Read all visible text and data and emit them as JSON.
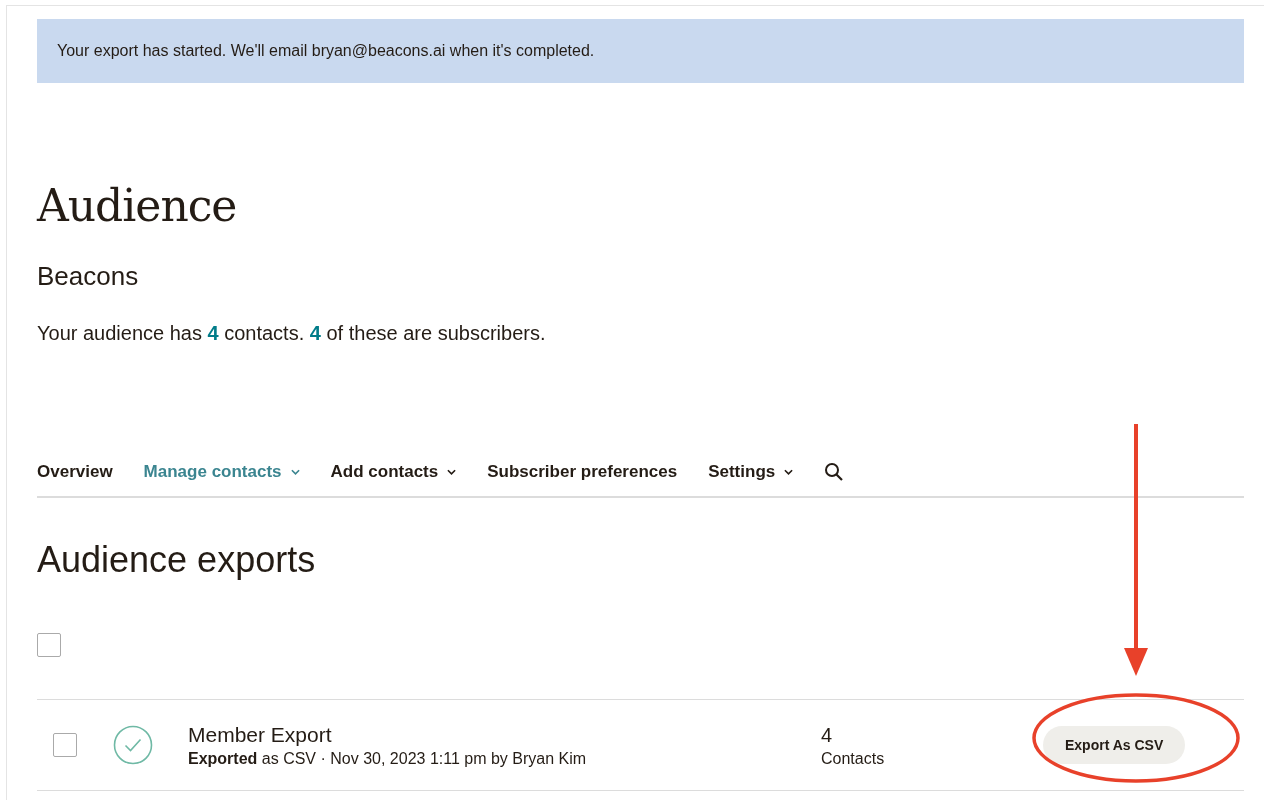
{
  "banner": {
    "text": "Your export has started. We'll email bryan@beacons.ai when it's completed."
  },
  "page_title": "Audience",
  "audience_name": "Beacons",
  "summary": [
    {
      "kind": "plain",
      "text": "Your audience has "
    },
    {
      "kind": "link",
      "text": "4"
    },
    {
      "kind": "plain",
      "text": " contacts. "
    },
    {
      "kind": "link",
      "text": "4"
    },
    {
      "kind": "plain",
      "text": " of these are subscribers."
    }
  ],
  "nav": [
    {
      "label": "Overview",
      "selected": false,
      "dropdown": false
    },
    {
      "label": "Manage contacts",
      "selected": true,
      "dropdown": true
    },
    {
      "label": "Add contacts",
      "selected": false,
      "dropdown": true
    },
    {
      "label": "Subscriber preferences",
      "selected": false,
      "dropdown": false
    },
    {
      "label": "Settings",
      "selected": false,
      "dropdown": true
    }
  ],
  "section_title": "Audience exports",
  "select_all": {
    "checked": false
  },
  "exports": [
    {
      "checked": false,
      "name": "Member Export",
      "details": "**Exported** as CSV · Nov 30, 2023 1:11 pm by Bryan Kim",
      "count": "4",
      "count_label": "Contacts",
      "button": "Export As CSV"
    }
  ]
}
